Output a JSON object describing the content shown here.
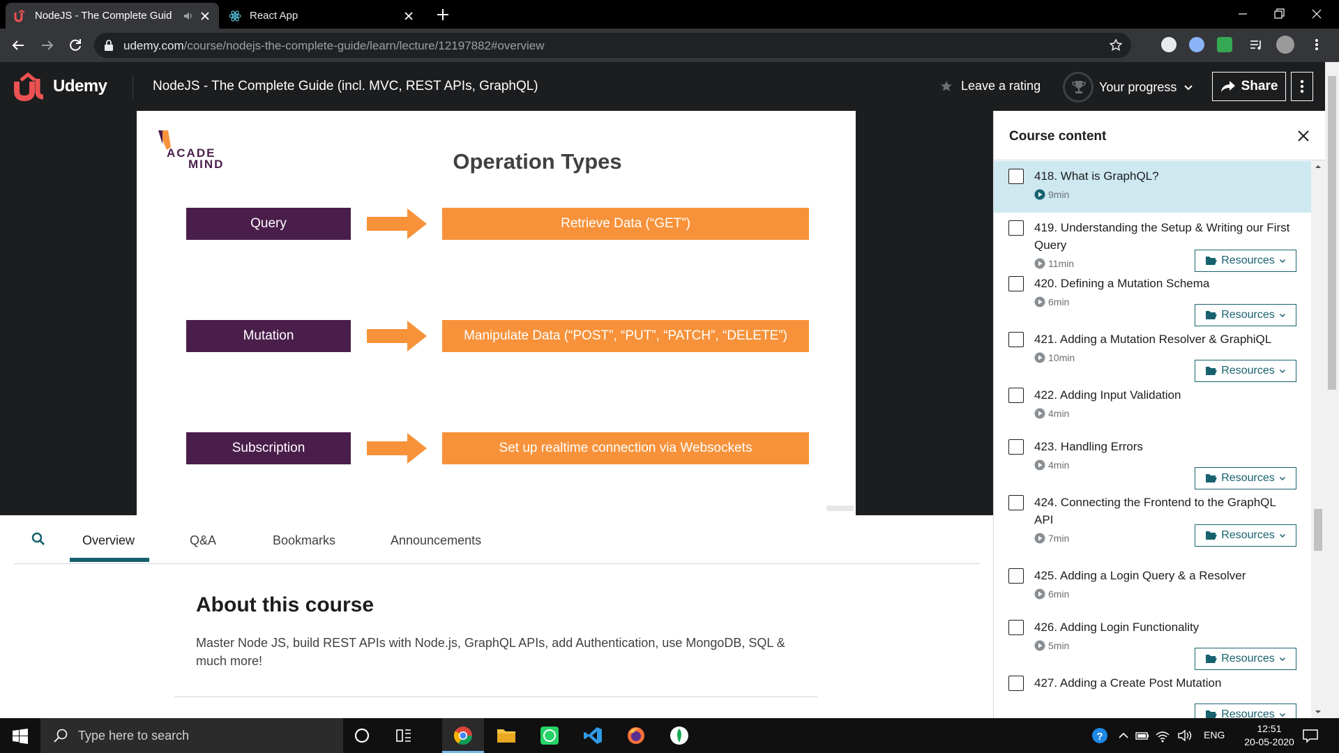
{
  "browser": {
    "tabs": [
      {
        "title": "NodeJS - The Complete Guid",
        "active": true
      },
      {
        "title": "React App",
        "active": false
      }
    ],
    "url_host": "udemy.com",
    "url_path": "/course/nodejs-the-complete-guide/learn/lecture/12197882#overview"
  },
  "header": {
    "brand": "Udemy",
    "course_title": "NodeJS - The Complete Guide (incl. MVC, REST APIs, GraphQL)",
    "rating_label": "Leave a rating",
    "progress_label": "Your progress",
    "share_label": "Share"
  },
  "slide": {
    "logo_line1": "ACADE",
    "logo_line2": "MIND",
    "title": "Operation Types",
    "rows": [
      {
        "op": "Query",
        "desc": "Retrieve Data (“GET”)"
      },
      {
        "op": "Mutation",
        "desc": "Manipulate Data (“POST”, “PUT”, “PATCH”, “DELETE”)"
      },
      {
        "op": "Subscription",
        "desc": "Set up realtime connection via Websockets"
      }
    ],
    "colors": {
      "op_box": "#4a1e4b",
      "desc_box": "#f7923a",
      "arrow": "#f7923a"
    }
  },
  "content_tabs": {
    "items": [
      "Overview",
      "Q&A",
      "Bookmarks",
      "Announcements"
    ],
    "active": "Overview"
  },
  "about": {
    "heading": "About this course",
    "description": "Master Node JS, build REST APIs with Node.js, GraphQL APIs, add Authentication, use MongoDB, SQL & much more!"
  },
  "sidebar": {
    "title": "Course content",
    "resources_label": "Resources",
    "lectures": [
      {
        "title": "418. What is GraphQL?",
        "duration": "9min",
        "resources": false,
        "current": true
      },
      {
        "title": "419. Understanding the Setup & Writing our First Query",
        "duration": "11min",
        "resources": true
      },
      {
        "title": "420. Defining a Mutation Schema",
        "duration": "6min",
        "resources": true
      },
      {
        "title": "421. Adding a Mutation Resolver & GraphiQL",
        "duration": "10min",
        "resources": true
      },
      {
        "title": "422. Adding Input Validation",
        "duration": "4min",
        "resources": false
      },
      {
        "title": "423. Handling Errors",
        "duration": "4min",
        "resources": true
      },
      {
        "title": "424. Connecting the Frontend to the GraphQL API",
        "duration": "7min",
        "resources": true
      },
      {
        "title": "425. Adding a Login Query & a Resolver",
        "duration": "6min",
        "resources": false
      },
      {
        "title": "426. Adding Login Functionality",
        "duration": "5min",
        "resources": true
      },
      {
        "title": "427. Adding a Create Post Mutation",
        "duration": "",
        "resources": true
      }
    ]
  },
  "taskbar": {
    "search_placeholder": "Type here to search",
    "language": "ENG",
    "time": "12:51",
    "date": "20-05-2020"
  },
  "theme": {
    "udemy_red": "#ec5252",
    "header_bg": "#1c1d1f",
    "teal": "#17616e",
    "current_row": "#cee8f0"
  }
}
